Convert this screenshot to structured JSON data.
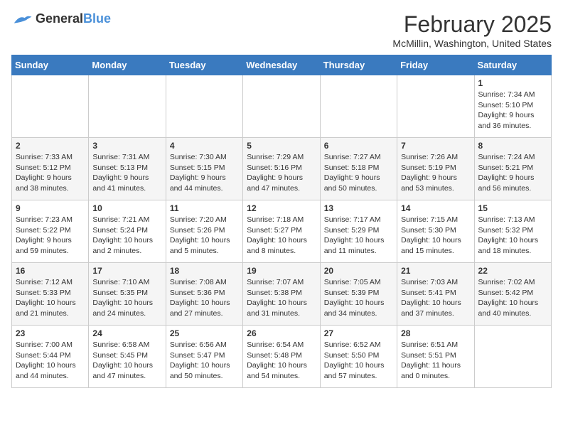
{
  "header": {
    "logo_general": "General",
    "logo_blue": "Blue",
    "title": "February 2025",
    "subtitle": "McMillin, Washington, United States"
  },
  "days_of_week": [
    "Sunday",
    "Monday",
    "Tuesday",
    "Wednesday",
    "Thursday",
    "Friday",
    "Saturday"
  ],
  "weeks": [
    [
      {
        "day": "",
        "info": ""
      },
      {
        "day": "",
        "info": ""
      },
      {
        "day": "",
        "info": ""
      },
      {
        "day": "",
        "info": ""
      },
      {
        "day": "",
        "info": ""
      },
      {
        "day": "",
        "info": ""
      },
      {
        "day": "1",
        "info": "Sunrise: 7:34 AM\nSunset: 5:10 PM\nDaylight: 9 hours and 36 minutes."
      }
    ],
    [
      {
        "day": "2",
        "info": "Sunrise: 7:33 AM\nSunset: 5:12 PM\nDaylight: 9 hours and 38 minutes."
      },
      {
        "day": "3",
        "info": "Sunrise: 7:31 AM\nSunset: 5:13 PM\nDaylight: 9 hours and 41 minutes."
      },
      {
        "day": "4",
        "info": "Sunrise: 7:30 AM\nSunset: 5:15 PM\nDaylight: 9 hours and 44 minutes."
      },
      {
        "day": "5",
        "info": "Sunrise: 7:29 AM\nSunset: 5:16 PM\nDaylight: 9 hours and 47 minutes."
      },
      {
        "day": "6",
        "info": "Sunrise: 7:27 AM\nSunset: 5:18 PM\nDaylight: 9 hours and 50 minutes."
      },
      {
        "day": "7",
        "info": "Sunrise: 7:26 AM\nSunset: 5:19 PM\nDaylight: 9 hours and 53 minutes."
      },
      {
        "day": "8",
        "info": "Sunrise: 7:24 AM\nSunset: 5:21 PM\nDaylight: 9 hours and 56 minutes."
      }
    ],
    [
      {
        "day": "9",
        "info": "Sunrise: 7:23 AM\nSunset: 5:22 PM\nDaylight: 9 hours and 59 minutes."
      },
      {
        "day": "10",
        "info": "Sunrise: 7:21 AM\nSunset: 5:24 PM\nDaylight: 10 hours and 2 minutes."
      },
      {
        "day": "11",
        "info": "Sunrise: 7:20 AM\nSunset: 5:26 PM\nDaylight: 10 hours and 5 minutes."
      },
      {
        "day": "12",
        "info": "Sunrise: 7:18 AM\nSunset: 5:27 PM\nDaylight: 10 hours and 8 minutes."
      },
      {
        "day": "13",
        "info": "Sunrise: 7:17 AM\nSunset: 5:29 PM\nDaylight: 10 hours and 11 minutes."
      },
      {
        "day": "14",
        "info": "Sunrise: 7:15 AM\nSunset: 5:30 PM\nDaylight: 10 hours and 15 minutes."
      },
      {
        "day": "15",
        "info": "Sunrise: 7:13 AM\nSunset: 5:32 PM\nDaylight: 10 hours and 18 minutes."
      }
    ],
    [
      {
        "day": "16",
        "info": "Sunrise: 7:12 AM\nSunset: 5:33 PM\nDaylight: 10 hours and 21 minutes."
      },
      {
        "day": "17",
        "info": "Sunrise: 7:10 AM\nSunset: 5:35 PM\nDaylight: 10 hours and 24 minutes."
      },
      {
        "day": "18",
        "info": "Sunrise: 7:08 AM\nSunset: 5:36 PM\nDaylight: 10 hours and 27 minutes."
      },
      {
        "day": "19",
        "info": "Sunrise: 7:07 AM\nSunset: 5:38 PM\nDaylight: 10 hours and 31 minutes."
      },
      {
        "day": "20",
        "info": "Sunrise: 7:05 AM\nSunset: 5:39 PM\nDaylight: 10 hours and 34 minutes."
      },
      {
        "day": "21",
        "info": "Sunrise: 7:03 AM\nSunset: 5:41 PM\nDaylight: 10 hours and 37 minutes."
      },
      {
        "day": "22",
        "info": "Sunrise: 7:02 AM\nSunset: 5:42 PM\nDaylight: 10 hours and 40 minutes."
      }
    ],
    [
      {
        "day": "23",
        "info": "Sunrise: 7:00 AM\nSunset: 5:44 PM\nDaylight: 10 hours and 44 minutes."
      },
      {
        "day": "24",
        "info": "Sunrise: 6:58 AM\nSunset: 5:45 PM\nDaylight: 10 hours and 47 minutes."
      },
      {
        "day": "25",
        "info": "Sunrise: 6:56 AM\nSunset: 5:47 PM\nDaylight: 10 hours and 50 minutes."
      },
      {
        "day": "26",
        "info": "Sunrise: 6:54 AM\nSunset: 5:48 PM\nDaylight: 10 hours and 54 minutes."
      },
      {
        "day": "27",
        "info": "Sunrise: 6:52 AM\nSunset: 5:50 PM\nDaylight: 10 hours and 57 minutes."
      },
      {
        "day": "28",
        "info": "Sunrise: 6:51 AM\nSunset: 5:51 PM\nDaylight: 11 hours and 0 minutes."
      },
      {
        "day": "",
        "info": ""
      }
    ]
  ]
}
